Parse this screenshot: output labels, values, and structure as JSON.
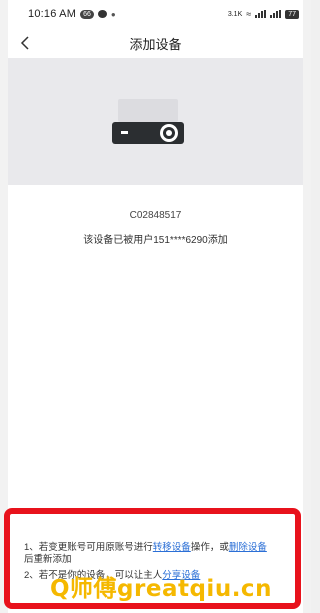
{
  "status_bar": {
    "time": "10:16 AM",
    "badge": "66",
    "net_speed": "3.1K",
    "battery": "77"
  },
  "nav": {
    "title": "添加设备"
  },
  "device": {
    "serial": "C02848517",
    "added_message": "该设备已被用户151****6290添加"
  },
  "notes": {
    "note1_prefix": "1、若变更账号可用原账号进行",
    "note1_link1": "转移设备",
    "note1_middle": "操作，或",
    "note1_link2": "删除设备",
    "note1_suffix": "后重新添加",
    "note2_prefix": "2、若不是你的设备，可以让主人",
    "note2_link": "分享设备"
  },
  "watermark": {
    "text": "Q师傅greatqiu.cn"
  },
  "colors": {
    "link": "#2b6fd6",
    "highlight_border": "#e8121c",
    "watermark": "#f5b800"
  }
}
